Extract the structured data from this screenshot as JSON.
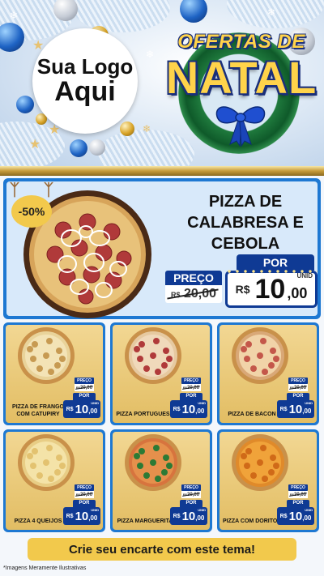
{
  "header": {
    "logo_line1": "Sua Logo",
    "logo_line2": "Aqui",
    "title_top": "OFERTAS DE",
    "title_main": "NATAL"
  },
  "featured": {
    "discount": "-50%",
    "name": "PIZZA DE CALABRESA E CEBOLA",
    "preco_label": "PREÇO",
    "old_currency": "R$",
    "old_price": "20,00",
    "por_label": "POR",
    "unit": "UNID",
    "new_currency": "R$",
    "new_int": "10",
    "new_dec": ",00"
  },
  "products": [
    {
      "name": "PIZZA DE FRANGO COM CATUPIRY",
      "preco_label": "PREÇO",
      "old_currency": "R$",
      "old_price": "20,00",
      "por_label": "POR",
      "unit": "UNID",
      "new_currency": "R$",
      "new_int": "10",
      "new_dec": ",00"
    },
    {
      "name": "PIZZA PORTUGUESA",
      "preco_label": "PREÇO",
      "old_currency": "R$",
      "old_price": "20,00",
      "por_label": "POR",
      "unit": "UNID",
      "new_currency": "R$",
      "new_int": "10",
      "new_dec": ",00"
    },
    {
      "name": "PIZZA DE BACON",
      "preco_label": "PREÇO",
      "old_currency": "R$",
      "old_price": "20,00",
      "por_label": "POR",
      "unit": "UNID",
      "new_currency": "R$",
      "new_int": "10",
      "new_dec": ",00"
    },
    {
      "name": "PIZZA 4 QUEIJOS",
      "preco_label": "PREÇO",
      "old_currency": "R$",
      "old_price": "20,00",
      "por_label": "POR",
      "unit": "UNID",
      "new_currency": "R$",
      "new_int": "10",
      "new_dec": ",00"
    },
    {
      "name": "PIZZA MARGUERITA",
      "preco_label": "PREÇO",
      "old_currency": "R$",
      "old_price": "20,00",
      "por_label": "POR",
      "unit": "UNID",
      "new_currency": "R$",
      "new_int": "10",
      "new_dec": ",00"
    },
    {
      "name": "PIZZA COM DORITOS",
      "preco_label": "PREÇO",
      "old_currency": "R$",
      "old_price": "20,00",
      "por_label": "POR",
      "unit": "UNID",
      "new_currency": "R$",
      "new_int": "10",
      "new_dec": ",00"
    }
  ],
  "cta": "Crie seu encarte com este tema!",
  "disclaimer": "*Imagens Meramente Ilustrativas",
  "colors": {
    "accent_blue": "#1e78d2",
    "price_navy": "#0f3a94",
    "gold": "#f2c94c",
    "card_gold": "#e2bd63"
  },
  "icons": [
    "christmas-ball-icon",
    "star-icon",
    "snowflake-icon",
    "bow-icon",
    "pizza-icon"
  ]
}
